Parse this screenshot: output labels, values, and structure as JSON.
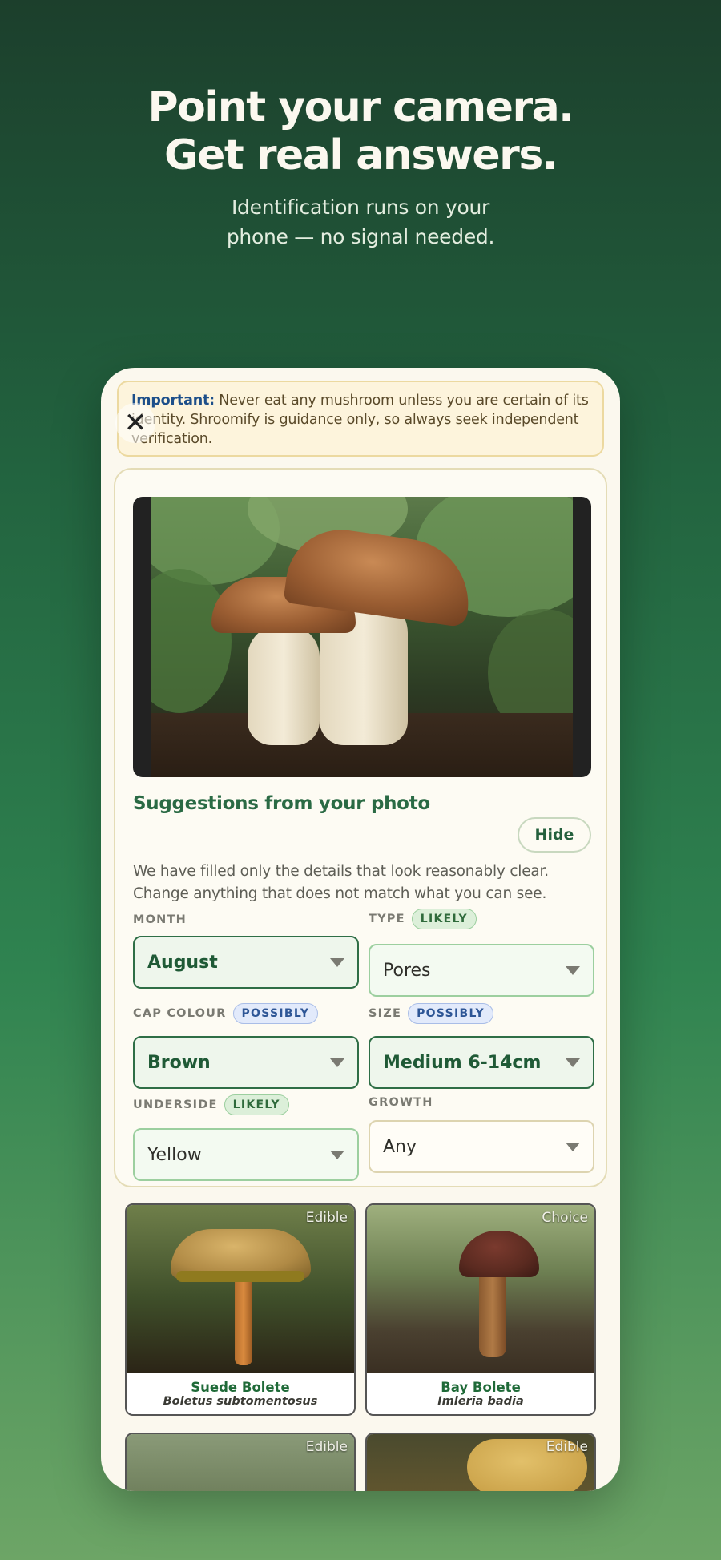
{
  "hero": {
    "title_line1": "Point your camera.",
    "title_line2": "Get real answers.",
    "subtitle_line1": "Identification runs on your",
    "subtitle_line2": "phone — no signal needed."
  },
  "warning": {
    "label": "Important:",
    "text": " Never eat any mushroom unless you are certain of its identity. Shroomify is guidance only, so always seek independent verification."
  },
  "close_icon": "close-icon",
  "suggestions": {
    "title": "Suggestions from your photo",
    "hide_label": "Hide",
    "description_line1": "We have filled only the details that look reasonably clear.",
    "description_line2": "Change anything that does not match what you can see."
  },
  "fields": {
    "month": {
      "label": "MONTH",
      "value": "August"
    },
    "type": {
      "label": "TYPE",
      "badge": "LIKELY",
      "value": "Pores"
    },
    "cap_colour": {
      "label": "CAP COLOUR",
      "badge": "POSSIBLY",
      "value": "Brown"
    },
    "size": {
      "label": "SIZE",
      "badge": "POSSIBLY",
      "value": "Medium 6-14cm"
    },
    "underside": {
      "label": "UNDERSIDE",
      "badge": "LIKELY",
      "value": "Yellow"
    },
    "growth": {
      "label": "GROWTH",
      "value": "Any"
    }
  },
  "results": [
    {
      "tag": "Edible",
      "name": "Suede Bolete",
      "scientific": "Boletus subtomentosus"
    },
    {
      "tag": "Choice",
      "name": "Bay Bolete",
      "scientific": "Imleria badia"
    },
    {
      "tag": "Edible"
    },
    {
      "tag": "Edible"
    }
  ],
  "colors": {
    "accent_green": "#2a6a44",
    "likely_badge": "#dcefd9",
    "possibly_badge": "#e2eafb",
    "warning_bg": "#fdf4dc"
  }
}
